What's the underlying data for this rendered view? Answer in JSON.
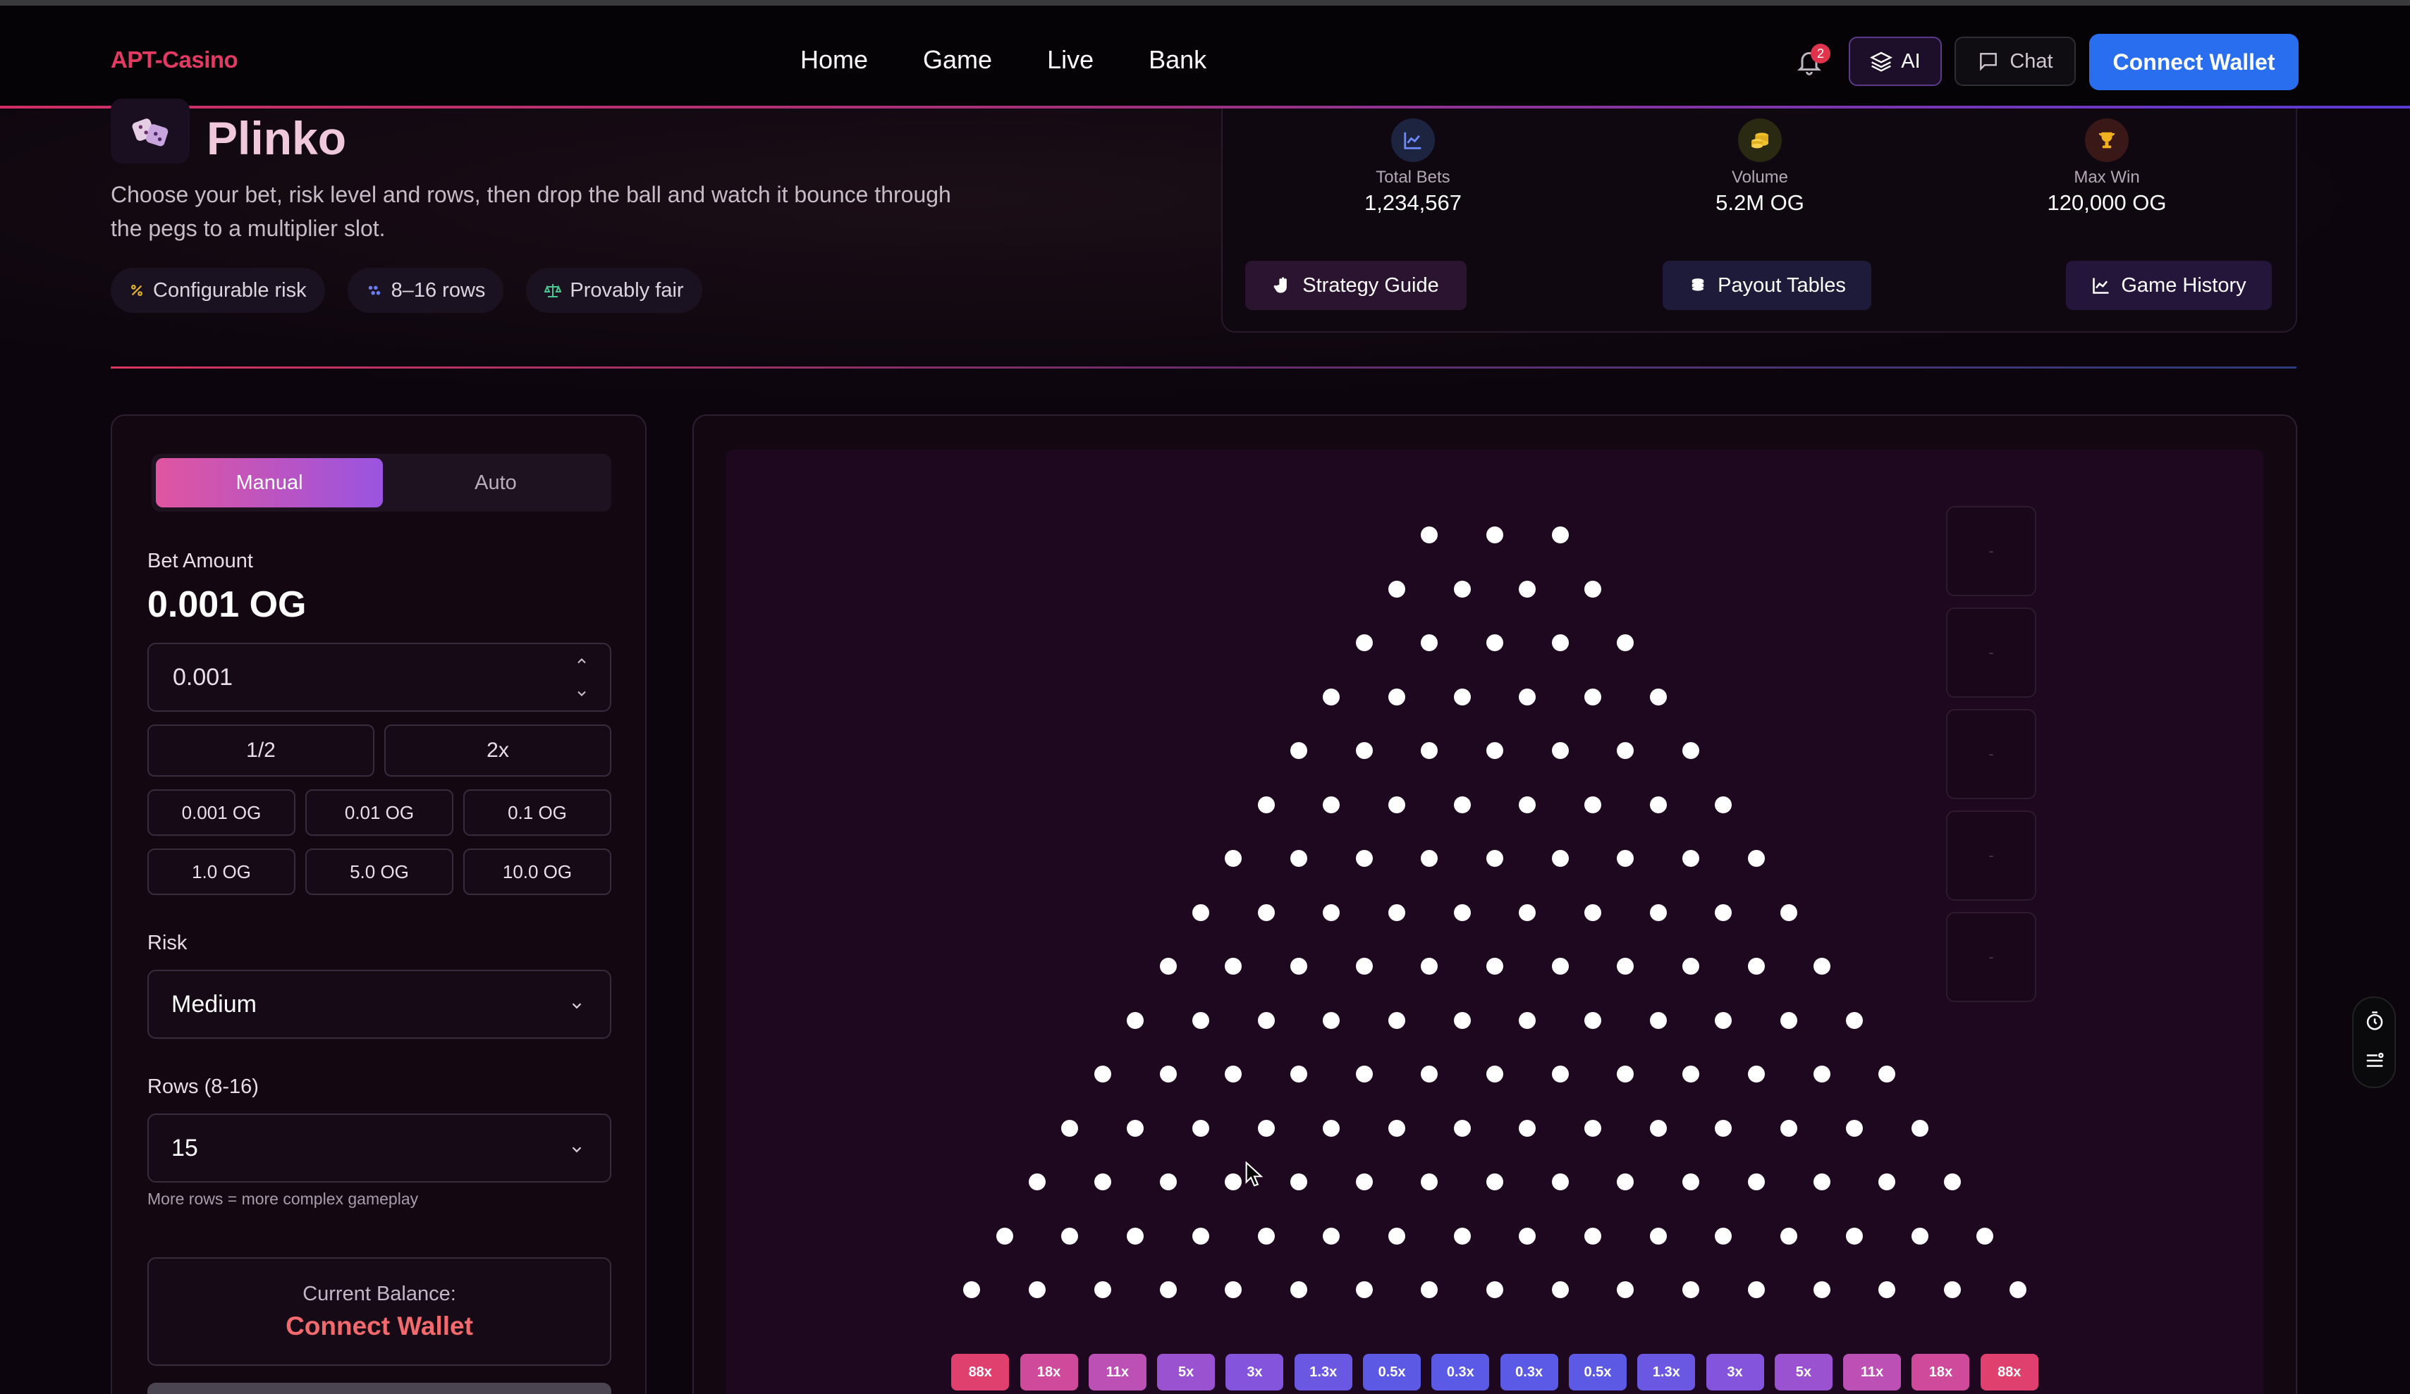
{
  "header": {
    "logo": "APT-Casino",
    "nav": [
      "Home",
      "Game",
      "Live",
      "Bank"
    ],
    "notification_count": "2",
    "ai_label": "AI",
    "chat_label": "Chat",
    "connect_label": "Connect Wallet"
  },
  "hero": {
    "title": "Plinko",
    "description": "Choose your bet, risk level and rows, then drop the ball and watch it bounce through the pegs to a multiplier slot.",
    "tags": [
      "Configurable risk",
      "8–16 rows",
      "Provably fair"
    ],
    "stats": [
      {
        "label": "Total Bets",
        "value": "1,234,567",
        "icon": "chart-line-icon",
        "color": "#4c6fe0"
      },
      {
        "label": "Volume",
        "value": "5.2M OG",
        "icon": "coins-icon",
        "color": "#e0b830"
      },
      {
        "label": "Max Win",
        "value": "120,000 OG",
        "icon": "trophy-icon",
        "color": "#e5a21f"
      }
    ],
    "buttons": [
      "Strategy Guide",
      "Payout Tables",
      "Game History"
    ]
  },
  "controls": {
    "tabs": [
      "Manual",
      "Auto"
    ],
    "bet_label": "Bet Amount",
    "bet_display": "0.001 OG",
    "bet_value": "0.001",
    "half_label": "1/2",
    "double_label": "2x",
    "presets": [
      "0.001 OG",
      "0.01 OG",
      "0.1 OG",
      "1.0 OG",
      "5.0 OG",
      "10.0 OG"
    ],
    "risk_label": "Risk",
    "risk_value": "Medium",
    "rows_label": "Rows (8-16)",
    "rows_value": "15",
    "rows_hint": "More rows = more complex gameplay",
    "balance_label": "Current Balance:",
    "balance_value": "Connect Wallet"
  },
  "board": {
    "rows": 15,
    "multipliers": [
      "88x",
      "18x",
      "11x",
      "5x",
      "3x",
      "1.3x",
      "0.5x",
      "0.3x",
      "0.3x",
      "0.5x",
      "1.3x",
      "3x",
      "5x",
      "11x",
      "18x",
      "88x"
    ],
    "slot_colors": [
      "#e0406e",
      "#cf4a9a",
      "#bd50b4",
      "#9b52d0",
      "#8455dc",
      "#6b58e2",
      "#5c5ae4",
      "#5a5ae6",
      "#5a5ae6",
      "#5c5ae4",
      "#6b58e2",
      "#8455dc",
      "#9b52d0",
      "#bd50b4",
      "#cf4a9a",
      "#e0406e"
    ],
    "history": [
      "-",
      "-",
      "-",
      "-",
      "-"
    ]
  }
}
